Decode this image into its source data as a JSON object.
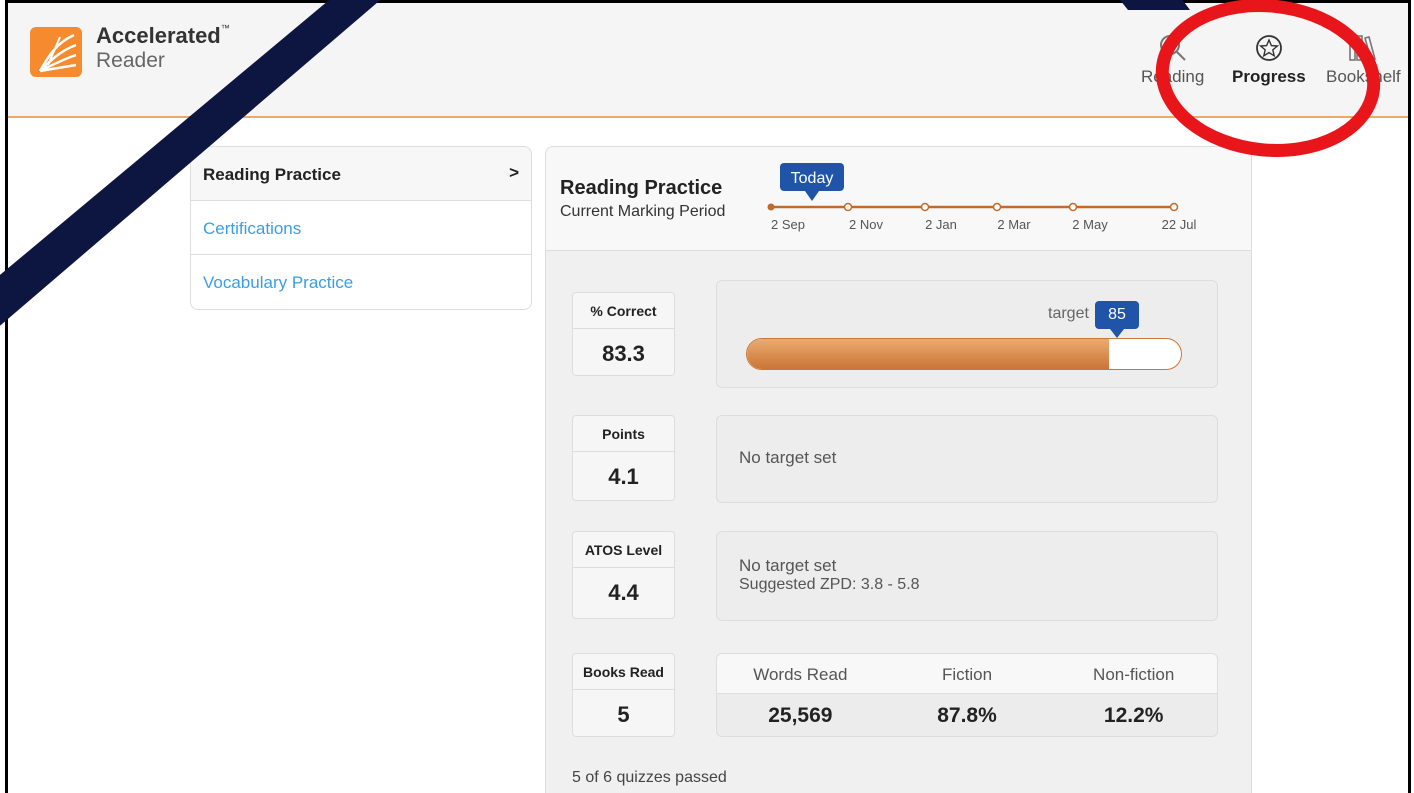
{
  "app": {
    "brand_title": "Accelerated",
    "brand_tm": "™",
    "brand_sub": "Reader",
    "accent_color": "#f58a2e"
  },
  "nav": {
    "items": [
      {
        "label": "Reading",
        "icon": "search-icon",
        "active": false
      },
      {
        "label": "Progress",
        "icon": "star-badge-icon",
        "active": true
      },
      {
        "label": "Bookshelf",
        "icon": "books-icon",
        "active": false
      }
    ]
  },
  "sidebar": {
    "items": [
      {
        "label": "Reading Practice",
        "active": true,
        "chevron": ">"
      },
      {
        "label": "Certifications",
        "active": false
      },
      {
        "label": "Vocabulary Practice",
        "active": false
      }
    ]
  },
  "main": {
    "title": "Reading Practice",
    "subtitle": "Current Marking Period",
    "timeline": {
      "today_label": "Today",
      "dates": [
        "2 Sep",
        "2 Nov",
        "2 Jan",
        "2 Mar",
        "2 May",
        "22 Jul"
      ]
    },
    "metrics": [
      {
        "label": "% Correct",
        "value": "83.3"
      },
      {
        "label": "Points",
        "value": "4.1"
      },
      {
        "label": "ATOS Level",
        "value": "4.4"
      },
      {
        "label": "Books Read",
        "value": "5"
      }
    ],
    "percent_correct": {
      "target_label": "target",
      "target_value": "85",
      "progress_percent": 83.3
    },
    "points_target": {
      "text": "No target set"
    },
    "atos_target": {
      "text": "No target set",
      "zpd": "Suggested ZPD: 3.8 - 5.8"
    },
    "books_stats": {
      "headers": [
        "Words Read",
        "Fiction",
        "Non-fiction"
      ],
      "values": [
        "25,569",
        "87.8%",
        "12.2%"
      ]
    },
    "quiz_summary": "5 of 6 quizzes passed"
  },
  "colors": {
    "link": "#3a9ee4",
    "badge": "#1f54a8",
    "progress": "#d9843f",
    "annotation_circle": "#e8161b",
    "annotation_arrow": "#0d1640"
  }
}
